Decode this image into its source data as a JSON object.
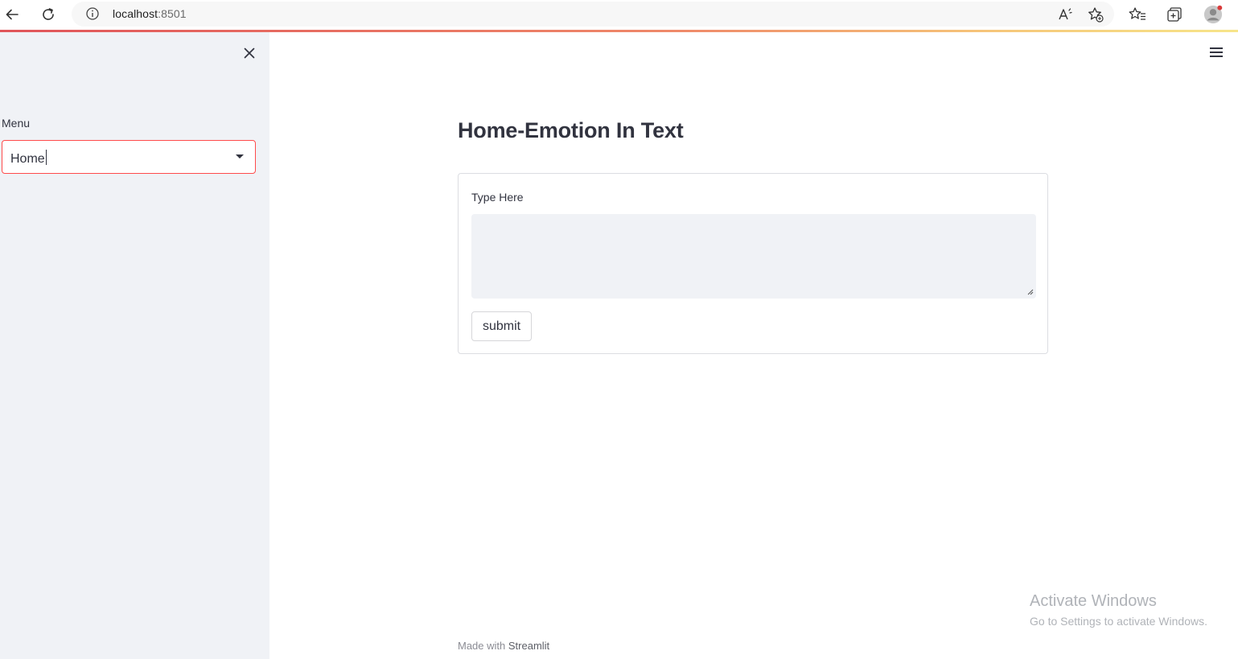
{
  "browser": {
    "url_host": "localhost",
    "url_port": ":8501",
    "icons": [
      "back-arrow-icon",
      "refresh-icon",
      "info-icon",
      "read-aloud-icon",
      "add-favorite-icon",
      "favorites-icon",
      "collections-icon",
      "profile-icon"
    ]
  },
  "sidebar": {
    "menu_label": "Menu",
    "selected_option": "Home",
    "accent_color": "#ff4b4b"
  },
  "main": {
    "title": "Home-Emotion In Text",
    "form": {
      "field_label": "Type Here",
      "text_value": "",
      "submit_label": "submit"
    }
  },
  "footer": {
    "prefix": "Made with",
    "brand": "Streamlit"
  },
  "watermark": {
    "title": "Activate Windows",
    "subtitle": "Go to Settings to activate Windows."
  }
}
